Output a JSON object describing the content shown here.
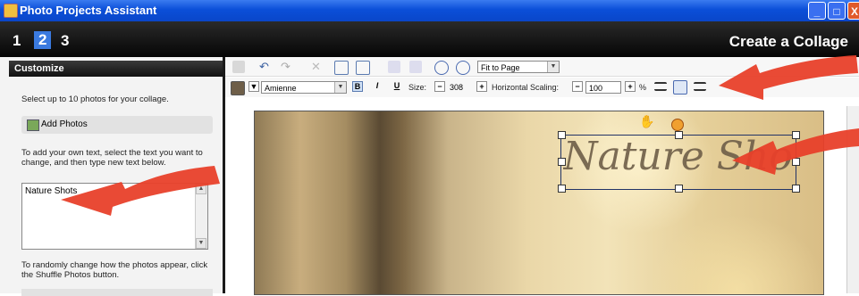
{
  "window": {
    "title": "Photo Projects Assistant",
    "min": "_",
    "max": "□",
    "close": "X"
  },
  "steps": {
    "items": [
      "1",
      "2",
      "3"
    ],
    "active": "2",
    "page_title": "Create a Collage"
  },
  "left_panel": {
    "header": "Customize",
    "instruction": "Select up to 10 photos for your collage.",
    "add_photos_label": "Add Photos",
    "text_instruction": "To add your own text, select the text you want to change, and then type new text below.",
    "text_value": "Nature Shots",
    "shuffle_instruction": "To randomly change how the photos appear, click the Shuffle Photos button."
  },
  "toolbar": {
    "zoom_value": "Fit to Page",
    "font_value": "Amienne",
    "bold_label": "B",
    "italic_label": "I",
    "underline_label": "U",
    "size_label": "Size:",
    "size_value": "308",
    "hscale_label": "Horizontal Scaling:",
    "hscale_value": "100",
    "percent": "%",
    "minus": "−",
    "plus": "+"
  },
  "canvas": {
    "text": "Nature Shots"
  },
  "colors": {
    "accent_blue": "#0b4fd8",
    "annotation_red": "#e8402a",
    "text_color_swatch": "#6e5e48"
  }
}
